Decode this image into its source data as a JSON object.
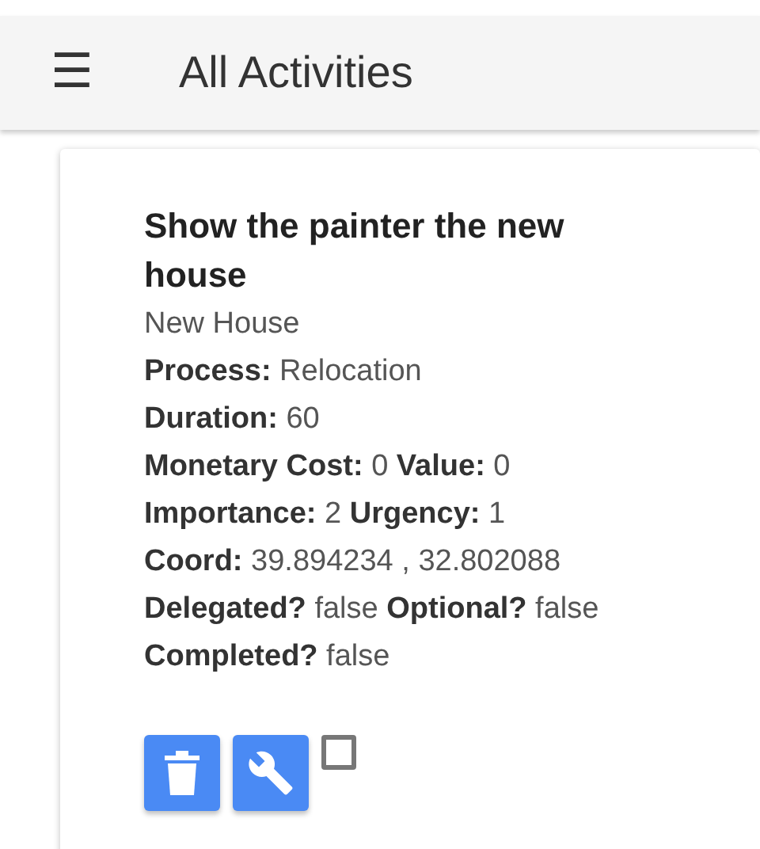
{
  "app_bar": {
    "menu_icon": "☰",
    "title": "All Activities"
  },
  "activity": {
    "title": "Show the painter the new house",
    "subtitle": "New House",
    "details": [
      "**Process:** Relocation",
      "**Duration:** 60",
      "**Monetary Cost:** 0 **Value:** 0",
      "**Importance:** 2 **Urgency:** 1",
      "**Coord:** 39.894234 , 32.802088",
      "**Delegated?** false **Optional?** false",
      "**Completed?** false"
    ],
    "completed_checkbox": {
      "checked": false
    }
  }
}
